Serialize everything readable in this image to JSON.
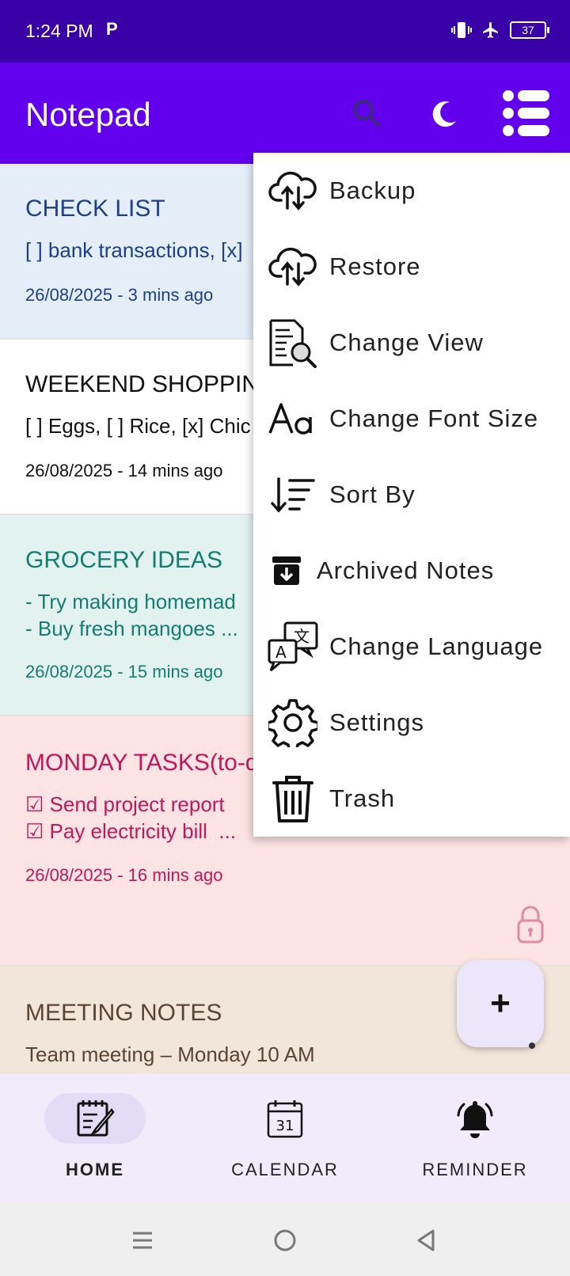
{
  "status_bar": {
    "time": "1:24 PM",
    "notif": "P",
    "battery": "37"
  },
  "app_bar": {
    "title": "Notepad"
  },
  "notes": [
    {
      "title": "CHECK LIST",
      "body": "[ ] bank transactions, [x]",
      "date": "26/08/2025 - 3 mins ago",
      "bg": "#e3eef9",
      "color": "#1f3f8a"
    },
    {
      "title": "WEEKEND SHOPPIN",
      "body": "[ ] Eggs, [ ] Rice, [x] Chic",
      "date": "26/08/2025 - 14 mins ago",
      "bg": "#ffffff",
      "color": "#111111"
    },
    {
      "title": "GROCERY IDEAS",
      "body": "- Try making homemad\n- Buy fresh mangoes ...",
      "date": "26/08/2025 - 15 mins ago",
      "bg": "#e2f2ef",
      "color": "#147c70"
    },
    {
      "title": "MONDAY TASKS(to-d",
      "body": "☑ Send project report\n☑ Pay electricity bill  ...",
      "date": "26/08/2025 - 16 mins ago",
      "bg": "#fde3e3",
      "color": "#c2185b"
    },
    {
      "title": "MEETING NOTES",
      "body": "Team meeting – Monday 10 AM",
      "date": "",
      "bg": "#f2e6da",
      "color": "#5a4436"
    }
  ],
  "menu": {
    "items": [
      {
        "label": "Backup",
        "icon": "cloud-sync-icon"
      },
      {
        "label": "Restore",
        "icon": "cloud-sync-icon"
      },
      {
        "label": "Change View",
        "icon": "document-search-icon"
      },
      {
        "label": "Change Font Size",
        "icon": "font-size-icon"
      },
      {
        "label": "Sort By",
        "icon": "sort-icon"
      },
      {
        "label": "Archived Notes",
        "icon": "archive-icon"
      },
      {
        "label": "Change Language",
        "icon": "translate-icon"
      },
      {
        "label": "Settings",
        "icon": "gear-icon"
      },
      {
        "label": "Trash",
        "icon": "trash-icon"
      }
    ]
  },
  "fab": {
    "label": "+"
  },
  "bottom_nav": {
    "items": [
      {
        "label": "HOME",
        "icon": "notepad-icon",
        "active": true
      },
      {
        "label": "CALENDAR",
        "icon": "calendar-icon",
        "active": false
      },
      {
        "label": "REMINDER",
        "icon": "bell-icon",
        "active": false
      }
    ],
    "calendar_day": "31"
  },
  "colors": {
    "status_bar": "#3a00a8",
    "app_bar": "#6200ee",
    "nav_bg": "#f1ebfb"
  }
}
